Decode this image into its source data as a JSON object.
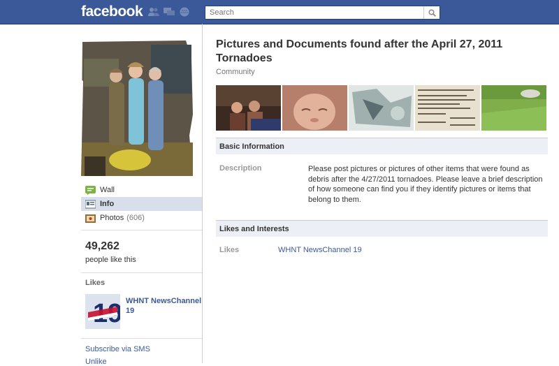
{
  "header": {
    "logo": "facebook",
    "search_placeholder": "Search",
    "jewels": [
      "friend-requests-icon",
      "messages-icon",
      "notifications-icon"
    ]
  },
  "sidebar": {
    "nav": [
      {
        "label": "Wall",
        "icon": "wall-icon"
      },
      {
        "label": "Info",
        "icon": "info-icon",
        "active": true
      },
      {
        "label": "Photos",
        "icon": "photos-icon",
        "count": "(606)"
      }
    ],
    "like_count": "49,262",
    "like_sub": "people like this",
    "likes_heading": "Likes",
    "liked_page": {
      "name": "WHNT NewsChannel 19"
    },
    "subscribe_sms": "Subscribe via SMS",
    "unlike": "Unlike"
  },
  "page": {
    "title": "Pictures and Documents found after the April 27, 2011 Tornadoes",
    "category": "Community"
  },
  "info": {
    "basic_heading": "Basic Information",
    "description_label": "Description",
    "description": "Please post pictures or pictures of other items that were found as debris after the 4/27/2011 tornadoes. Please leave a brief description of how someone can find you if they identify pictures or items that belong to them.",
    "likes_heading": "Likes and Interests",
    "likes_label": "Likes",
    "likes_value": "WHNT NewsChannel 19"
  },
  "colors": {
    "brand": "#3b5998",
    "section_bg": "#eceff5",
    "active_nav": "#d8dfea"
  }
}
